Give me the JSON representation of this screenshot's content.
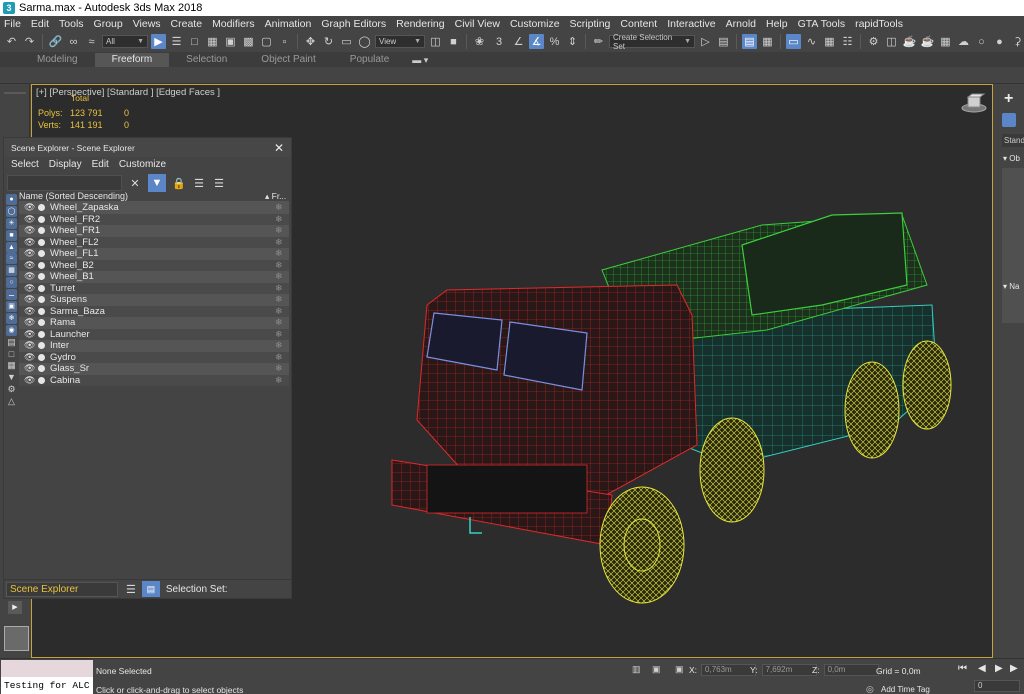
{
  "window": {
    "title": "Sarma.max - Autodesk 3ds Max 2018",
    "app_icon": "3ds-max-icon"
  },
  "menu": [
    "File",
    "Edit",
    "Tools",
    "Group",
    "Views",
    "Create",
    "Modifiers",
    "Animation",
    "Graph Editors",
    "Rendering",
    "Civil View",
    "Customize",
    "Scripting",
    "Content",
    "Interactive",
    "Arnold",
    "Help",
    "GTA Tools",
    "rapidTools"
  ],
  "toolbar": {
    "selection_filter": "All",
    "reference_coord": "View",
    "snap_label": "3",
    "named_selection": "Create Selection Set"
  },
  "ribbon": {
    "tabs": [
      "Modeling",
      "Freeform",
      "Selection",
      "Object Paint",
      "Populate"
    ],
    "active": "Freeform"
  },
  "viewport": {
    "label": "[+] [Perspective] [Standard ] [Edged Faces ]",
    "stats": {
      "total_label": "Total",
      "rows": [
        {
          "label": "Polys:",
          "total": "123 791",
          "selected": "0"
        },
        {
          "label": "Verts:",
          "total": "141 191",
          "selected": "0"
        }
      ]
    }
  },
  "scene_explorer": {
    "title": "Scene Explorer - Scene Explorer",
    "menu": [
      "Select",
      "Display",
      "Edit",
      "Customize"
    ],
    "column_name": "Name (Sorted Descending)",
    "column_frozen": "▴ Fr...",
    "items": [
      "Wheel_Zapaska",
      "Wheel_FR2",
      "Wheel_FR1",
      "Wheel_FL2",
      "Wheel_FL1",
      "Wheel_B2",
      "Wheel_B1",
      "Turret",
      "Suspens",
      "Sarma_Baza",
      "Rama",
      "Launcher",
      "Inter",
      "Gydro",
      "Glass_Sr",
      "Cabina"
    ],
    "footer_dropdown": "Scene Explorer",
    "selection_set_label": "Selection Set:"
  },
  "command_panel": {
    "dropdown": "Standa",
    "rollout1": "Ob",
    "rollout2": "Na"
  },
  "status": {
    "maxscript_text": "Testing for ALC",
    "selection": "None Selected",
    "hint": "Click or click-and-drag to select objects",
    "x_label": "X:",
    "x_value": "0,763m",
    "y_label": "Y:",
    "y_value": "7,692m",
    "z_label": "Z:",
    "z_value": "0,0m",
    "grid": "Grid = 0,0m",
    "add_time_tag": "Add Time Tag",
    "frame": "0"
  },
  "colors": {
    "accent": "#5b87c8",
    "viewport_border": "#c8a23e",
    "stats_text": "#e8c23e",
    "wire_cab": "#e02a2a",
    "wire_wheels": "#e6e63a",
    "wire_launcher": "#3ccf3c",
    "wire_chassis": "#35d0c0"
  }
}
